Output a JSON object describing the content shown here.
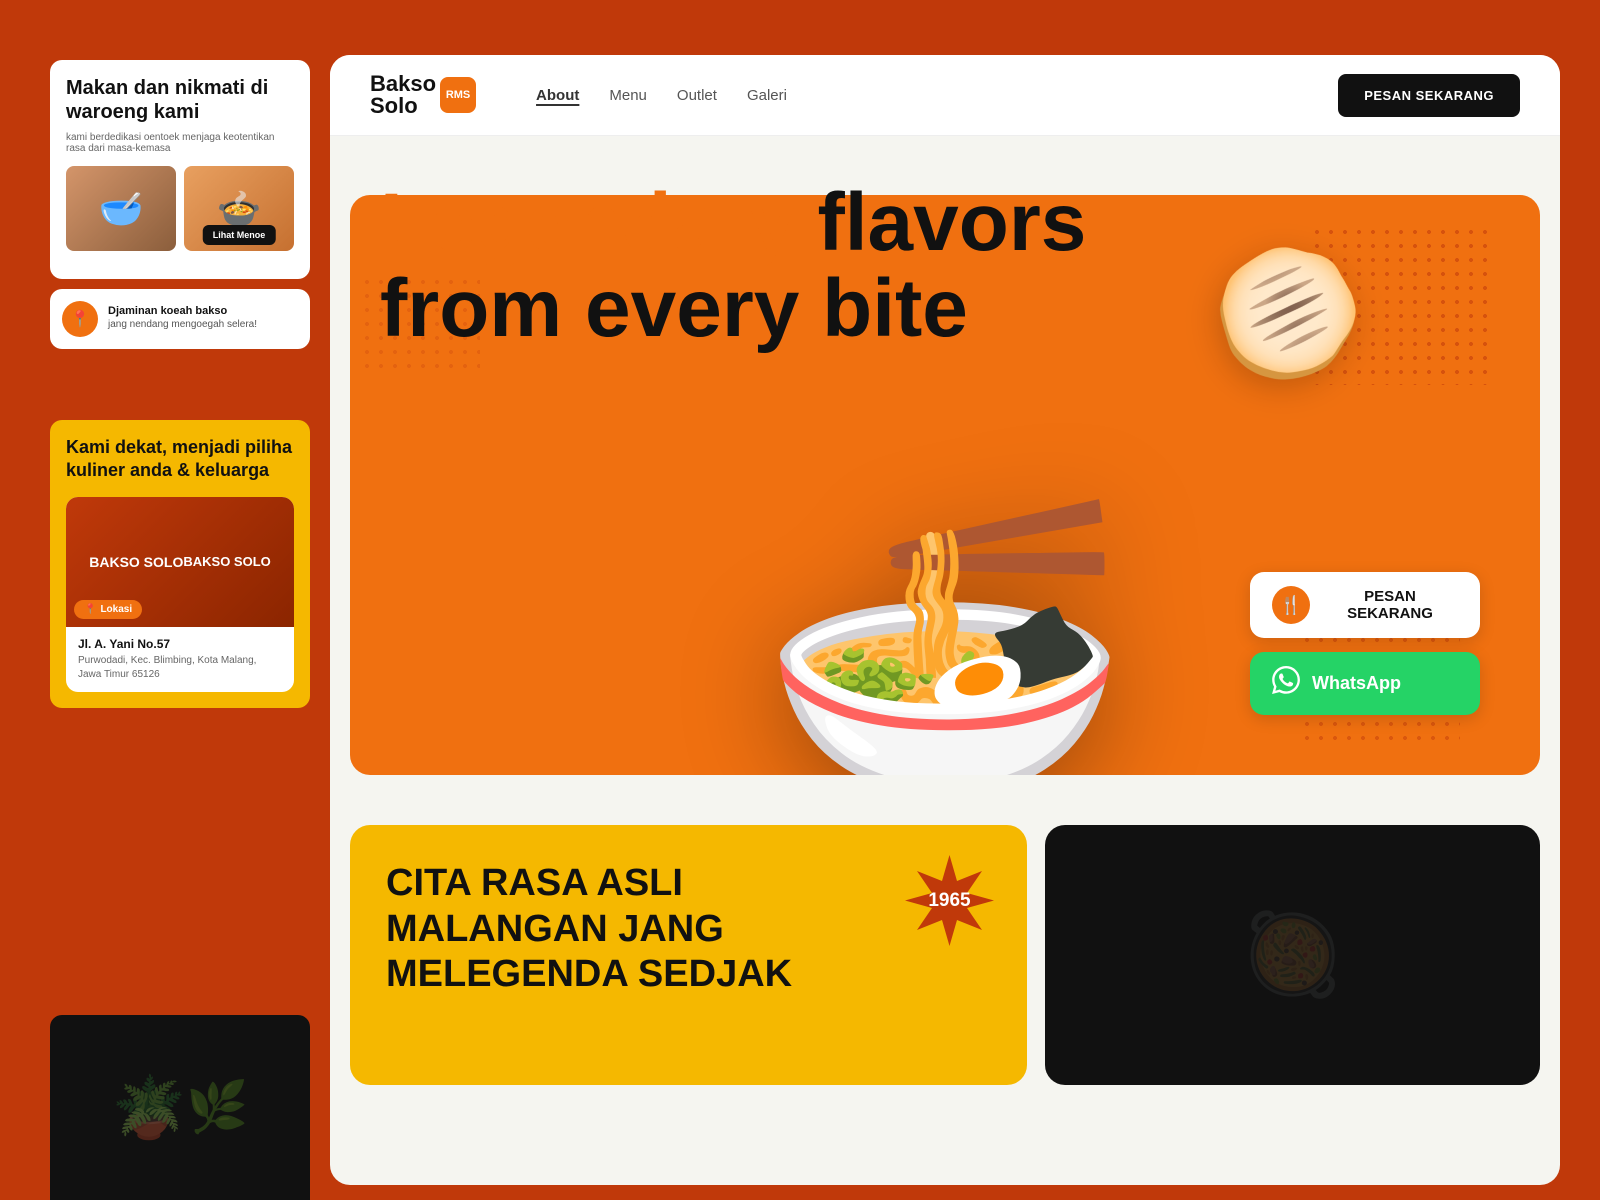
{
  "brand": {
    "name": "Bakso",
    "name2": "Solo",
    "tagline": "RMS",
    "logo_icon": "●"
  },
  "navbar": {
    "links": [
      {
        "label": "About",
        "active": true
      },
      {
        "label": "Menu",
        "active": false
      },
      {
        "label": "Outlet",
        "active": false
      },
      {
        "label": "Galeri",
        "active": false
      }
    ],
    "cta_button": "PESAN SEKARANG"
  },
  "hero": {
    "headline_orange": "Legendary",
    "headline_black": " flavors",
    "headline_line2": "from every bite"
  },
  "actions": {
    "pesan_label": "PESAN SEKARANG",
    "whatsapp_label": "WhatsApp"
  },
  "left_panel": {
    "title": "Makan dan nikmati di waroeng kami",
    "subtitle": "kami berdedikasi oentoek menjaga keotentikan rasa dari masa-kemasa",
    "lihat_menu": "Lihat Menoe",
    "guarantee_title": "Djaminan koeah bakso",
    "guarantee_desc": "jang nendang mengoegah selera!",
    "section_title": "Kami dekat, menjadi piliha kuliner anda & keluarga",
    "lokasi_label": "Lokasi",
    "outlet_name": "Jl. A. Yani No.57",
    "outlet_address": "Purwodadi, Kec. Blimbing, Kota Malang, Jawa Timur 65126"
  },
  "bottom": {
    "yellow_card": {
      "title_line1": "CITA RASA ASLI",
      "title_line2": "MALANGAN JANG",
      "title_line3": "MELEGENDA SEDJAK",
      "year": "1965"
    }
  },
  "colors": {
    "orange": "#f07010",
    "dark_orange": "#c0390a",
    "yellow": "#f5b800",
    "green": "#25d366",
    "black": "#111111",
    "white": "#ffffff",
    "light_bg": "#f5f5f0"
  }
}
